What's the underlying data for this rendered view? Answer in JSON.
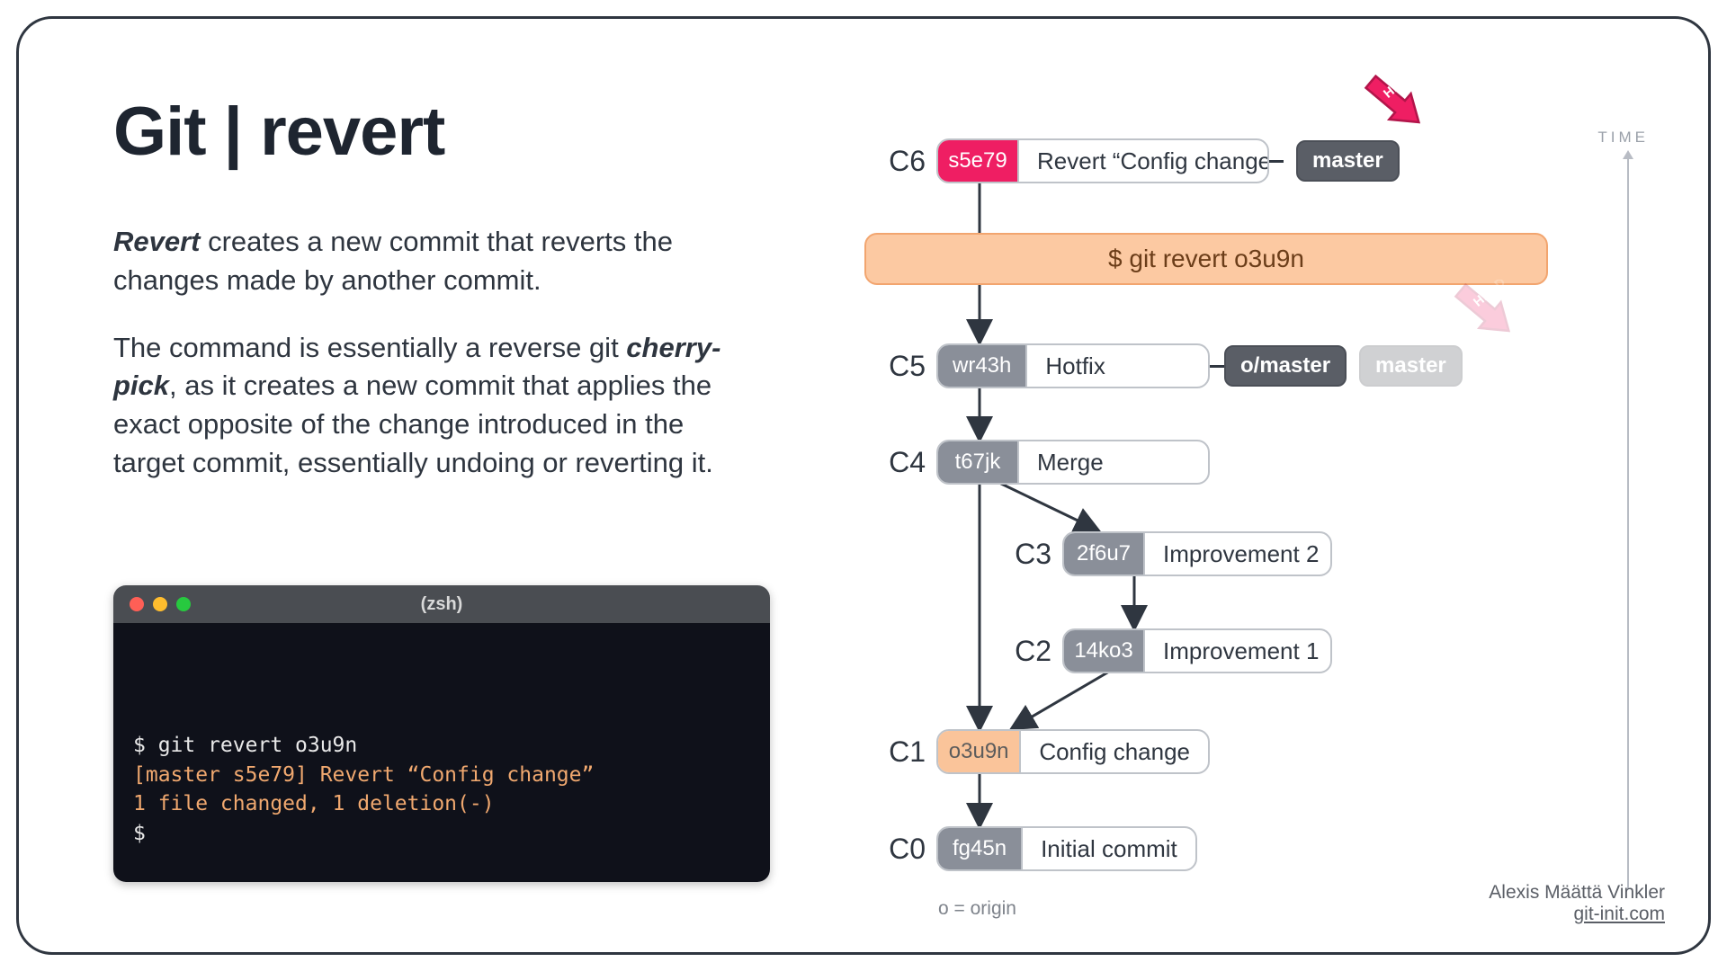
{
  "title": {
    "left": "Git",
    "sep": "|",
    "right": "revert"
  },
  "para1": {
    "lead": "Revert",
    "rest": " creates a new commit that reverts the changes made by another commit."
  },
  "para2": {
    "a": "The command is essentially a reverse git ",
    "b": "cherry-pick",
    "c": ", as it creates a new commit that applies the exact opposite of the change introduced in the target commit, essentially undoing or reverting it."
  },
  "terminal": {
    "title": "(zsh)",
    "l1": "$ git revert o3u9n",
    "l2": "[master s5e79] Revert “Config change”",
    "l3": "1 file changed, 1 deletion(-)",
    "l4": "$"
  },
  "cmd": "$ git revert o3u9n",
  "commits": {
    "c6": {
      "n": "C6",
      "hash": "s5e79",
      "msg": "Revert “Config change”"
    },
    "c5": {
      "n": "C5",
      "hash": "wr43h",
      "msg": "Hotfix"
    },
    "c4": {
      "n": "C4",
      "hash": "t67jk",
      "msg": "Merge"
    },
    "c3": {
      "n": "C3",
      "hash": "2f6u7",
      "msg": "Improvement 2"
    },
    "c2": {
      "n": "C2",
      "hash": "14ko3",
      "msg": "Improvement 1"
    },
    "c1": {
      "n": "C1",
      "hash": "o3u9n",
      "msg": "Config change"
    },
    "c0": {
      "n": "C0",
      "hash": "fg45n",
      "msg": "Initial commit"
    }
  },
  "tags": {
    "master": "master",
    "omaster": "o/master",
    "masterGhost": "master"
  },
  "head": "HEAD",
  "time": "TIME",
  "origin": "o = origin",
  "credits": {
    "name": "Alexis Määttä Vinkler",
    "site": "git-init.com"
  }
}
